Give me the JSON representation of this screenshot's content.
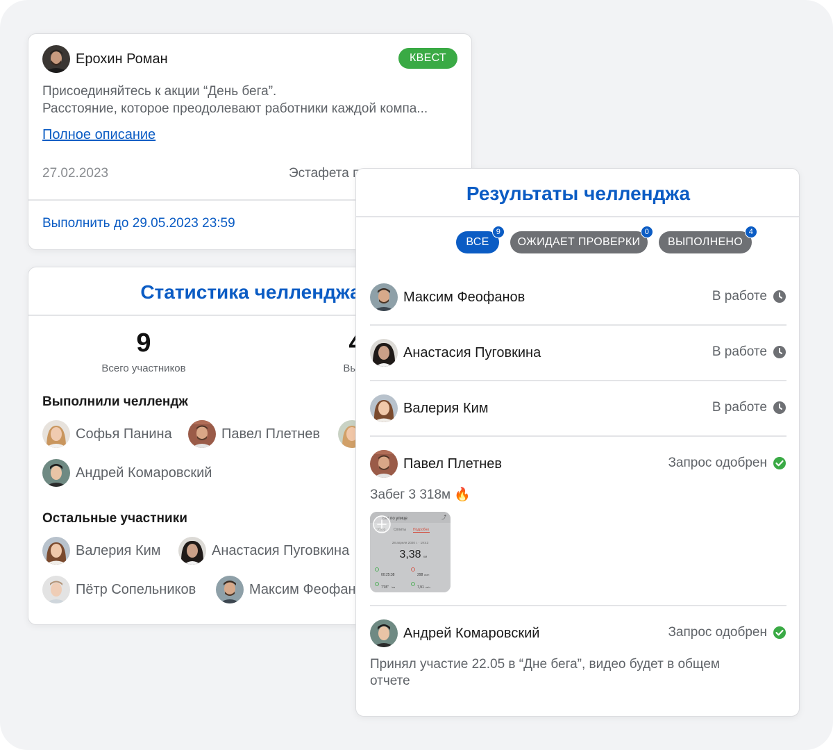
{
  "quest": {
    "author": "Ерохин Роман",
    "badge": "КВЕСТ",
    "desc_line1": "Присоединяйтесь к акции “День бега”.",
    "desc_line2": "Расстояние, которое преодолевают работники каждой компа...",
    "full_link": "Полное описание",
    "date": "27.02.2023",
    "type_label": "Эстафета п",
    "deadline": "Выполнить до 29.05.2023 23:59"
  },
  "stats": {
    "title": "Статистика челленджа",
    "total_num": "9",
    "total_label": "Всего участников",
    "done_num": "4",
    "done_label": "Выпо",
    "done_section": "Выполнили челлендж",
    "done_people": [
      "Софья Панина",
      "Павел Плетнев",
      "Андрей Комаровский"
    ],
    "other_section": "Остальные участники",
    "other_people": [
      "Валерия Ким",
      "Анастасия Пуговкина",
      "Пётр Сопельников",
      "Максим Феофан"
    ]
  },
  "results": {
    "title": "Результаты челленджа",
    "filters": [
      {
        "label": "ВСЕ",
        "count": "9"
      },
      {
        "label": "ОЖИДАЕТ ПРОВЕРКИ",
        "count": "0"
      },
      {
        "label": "ВЫПОЛНЕНО",
        "count": "4"
      }
    ],
    "rows": [
      {
        "name": "Максим Феофанов",
        "status": "В работе",
        "status_icon": "clock-icon"
      },
      {
        "name": "Анастасия Пуговкина",
        "status": "В работе",
        "status_icon": "clock-icon"
      },
      {
        "name": "Валерия Ким",
        "status": "В работе",
        "status_icon": "clock-icon"
      },
      {
        "name": "Павел Плетнев",
        "status": "Запрос одобрен",
        "status_icon": "check-circle-icon",
        "comment": "Забег 3 318м 🔥"
      },
      {
        "name": "Андрей Комаровский",
        "status": "Запрос одобрен",
        "status_icon": "check-circle-icon",
        "comment": "Принял участие 22.05 в “Дне бега”, видео будет в общем отчете"
      }
    ],
    "screenshot": {
      "header": "Бег по улице",
      "tabs": [
        "Обзор",
        "Сплиты",
        "Подробно"
      ],
      "date": "28 апреля 2020 г. · 19:43",
      "distance": "3,38",
      "distance_unit": "км",
      "duration": "00:25:38",
      "calories": "298",
      "calories_unit": "ккал",
      "pace": "7'35\"",
      "pace_unit": "/км",
      "speed": "7,91",
      "speed_unit": "км/ч"
    }
  },
  "colors": {
    "accent": "#0b5cc4",
    "success": "#3aaa45",
    "muted_chip": "#6e7074",
    "background": "#f2f3f5"
  }
}
